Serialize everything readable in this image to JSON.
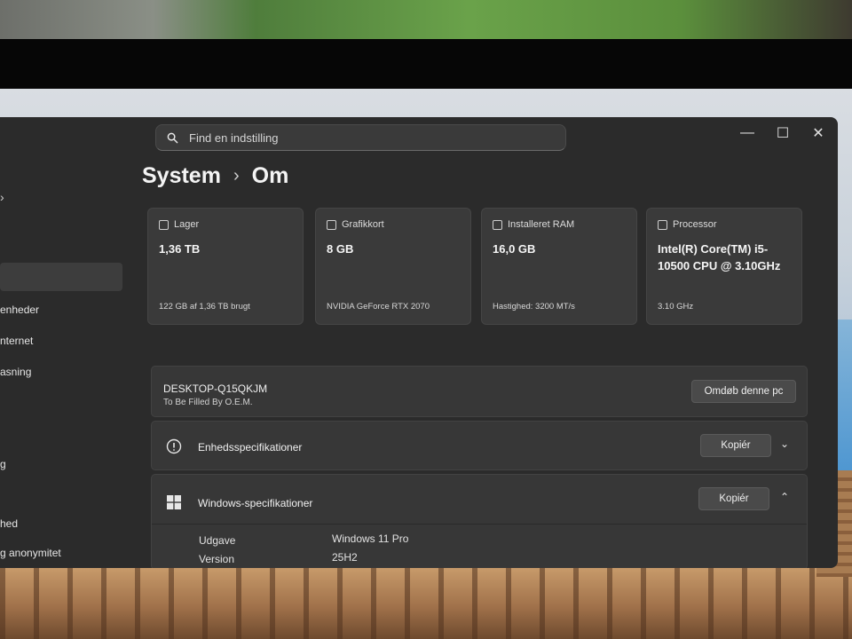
{
  "search": {
    "placeholder": "Find en indstilling"
  },
  "window_controls": {
    "minimize": "—",
    "maximize": "☐",
    "close": "✕"
  },
  "breadcrumb": {
    "parent": "System",
    "separator": "›",
    "current": "Om"
  },
  "sidebar": {
    "items": [
      {
        "label": "enheder"
      },
      {
        "label": "nternet"
      },
      {
        "label": "asning"
      },
      {
        "label": "g"
      },
      {
        "label": "hed"
      },
      {
        "label": "g anonymitet"
      }
    ]
  },
  "cards": [
    {
      "title": "Lager",
      "value": "1,36 TB",
      "detail": "122 GB af 1,36 TB brugt",
      "icon": "storage-icon"
    },
    {
      "title": "Grafikkort",
      "value": "8 GB",
      "detail": "NVIDIA GeForce RTX 2070",
      "icon": "graphics-card-icon"
    },
    {
      "title": "Installeret RAM",
      "value": "16,0 GB",
      "detail": "Hastighed: 3200 MT/s",
      "icon": "ram-icon"
    },
    {
      "title": "Processor",
      "value": "Intel(R) Core(TM) i5-10500 CPU @ 3.10GHz",
      "detail": "3.10 GHz",
      "icon": "processor-icon"
    }
  ],
  "device": {
    "name": "DESKTOP-Q15QKJM",
    "model": "To Be Filled By O.E.M.",
    "rename_button": "Omdøb denne pc"
  },
  "device_specs": {
    "title": "Enhedsspecifikationer",
    "copy_button": "Kopiér",
    "icon": "info-icon"
  },
  "windows_specs": {
    "title": "Windows-specifikationer",
    "copy_button": "Kopiér",
    "icon": "windows-logo-icon",
    "rows": [
      {
        "label": "Udgave",
        "value": "Windows 11 Pro"
      },
      {
        "label": "Version",
        "value": "25H2"
      }
    ]
  }
}
